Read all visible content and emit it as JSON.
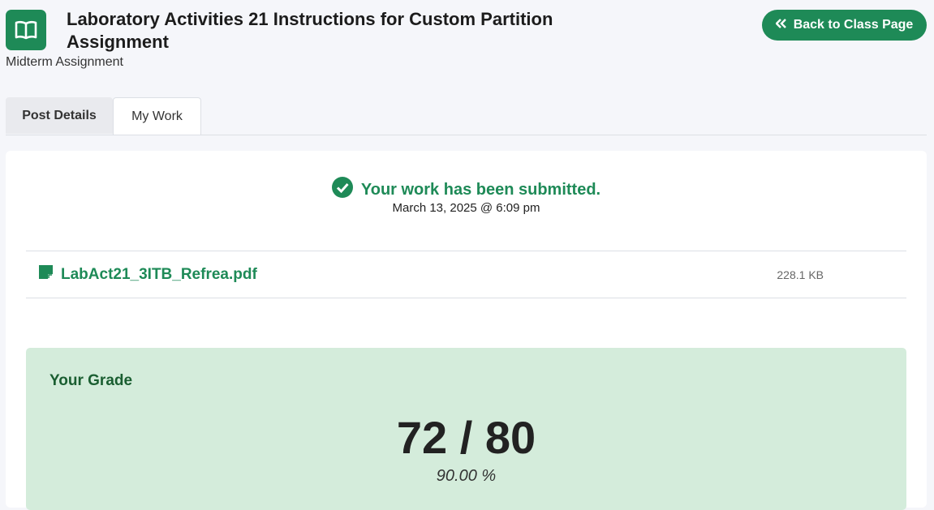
{
  "header": {
    "title": "Laboratory Activities 21 Instructions for Custom Partition Assignment",
    "subtitle": "Midterm Assignment",
    "back_label": "Back to Class Page",
    "icon": "book-open-icon"
  },
  "tabs": [
    {
      "label": "Post Details",
      "active": false
    },
    {
      "label": "My Work",
      "active": true
    }
  ],
  "submission": {
    "status": "Your work has been submitted.",
    "date": "March 13, 2025 @ 6:09 pm"
  },
  "file": {
    "name": "LabAct21_3ITB_Refrea.pdf",
    "size": "228.1 KB",
    "icon": "file-icon"
  },
  "grade": {
    "label": "Your Grade",
    "score": "72 / 80",
    "percent": "90.00 %"
  },
  "colors": {
    "brand": "#1e8a57",
    "grade_bg": "#d4ecdb",
    "grade_label": "#1a5e31"
  }
}
